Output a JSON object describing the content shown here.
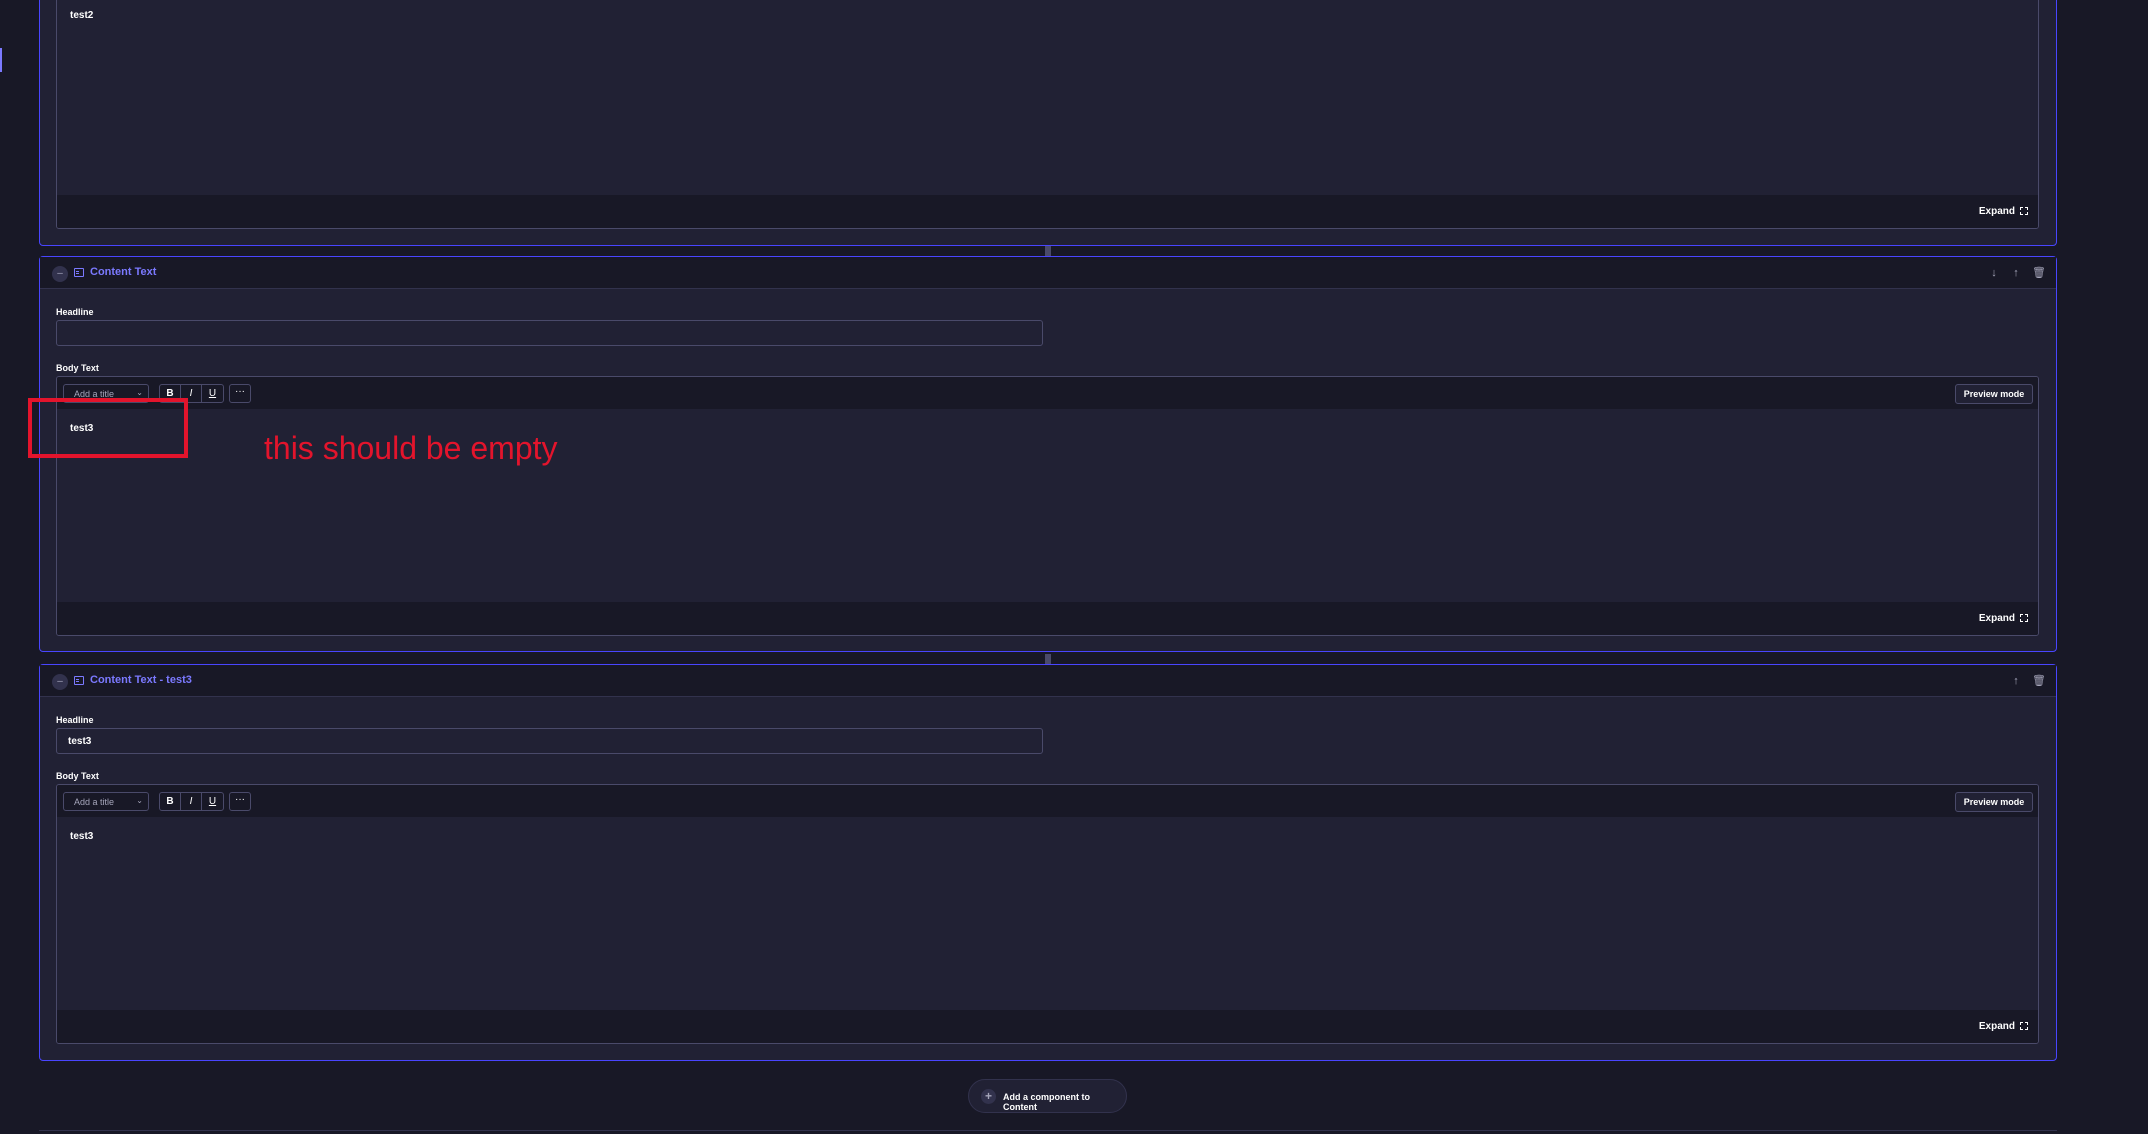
{
  "top_card": {
    "body_text": "test2",
    "expand_label": "Expand"
  },
  "card1": {
    "title": "Content Text",
    "headline_label": "Headline",
    "headline_value": "",
    "body_label": "Body Text",
    "title_select_placeholder": "Add a title",
    "format_buttons": [
      "B",
      "I",
      "U"
    ],
    "more_label": "···",
    "preview_label": "Preview mode",
    "body_text": "test3",
    "expand_label": "Expand",
    "actions": [
      "↓",
      "↑",
      "🗑"
    ]
  },
  "card2": {
    "title": "Content Text - test3",
    "headline_label": "Headline",
    "headline_value": "test3",
    "body_label": "Body Text",
    "title_select_placeholder": "Add a title",
    "format_buttons": [
      "B",
      "I",
      "U"
    ],
    "more_label": "···",
    "preview_label": "Preview mode",
    "body_text": "test3",
    "expand_label": "Expand",
    "actions": [
      "↑",
      "🗑"
    ]
  },
  "add_component_label": "Add a component to Content",
  "annotation_text": "this should be empty",
  "colors": {
    "background": "#181826",
    "panel": "#212134",
    "accent": "#7b79ff",
    "annotation": "#e3142c"
  }
}
